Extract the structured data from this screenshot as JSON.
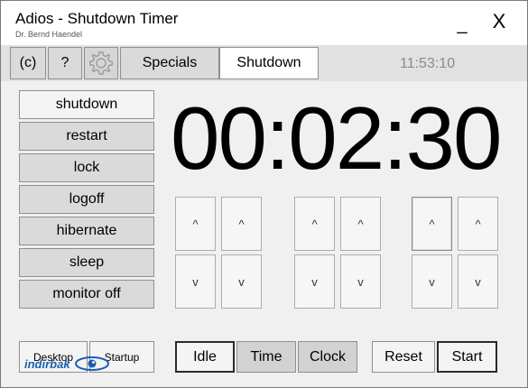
{
  "window": {
    "title": "Adios - Shutdown Timer",
    "subtitle": "Dr. Bernd Haendel",
    "minimize_label": "_",
    "close_label": "X"
  },
  "toolbar": {
    "copyright_label": "(c)",
    "help_label": "?",
    "specials_label": "Specials",
    "shutdown_label": "Shutdown",
    "current_time": "11:53:10"
  },
  "actions": [
    {
      "label": "shutdown",
      "selected": true
    },
    {
      "label": "restart",
      "selected": false
    },
    {
      "label": "lock",
      "selected": false
    },
    {
      "label": "logoff",
      "selected": false
    },
    {
      "label": "hibernate",
      "selected": false
    },
    {
      "label": "sleep",
      "selected": false
    },
    {
      "label": "monitor off",
      "selected": false
    }
  ],
  "timer": {
    "display": "00:02:30"
  },
  "spinners": {
    "up_glyph": "^",
    "down_glyph": "v"
  },
  "bottom": {
    "desktop_label": "Desktop",
    "startup_label": "Startup",
    "idle_label": "Idle",
    "time_label": "Time",
    "clock_label": "Clock",
    "reset_label": "Reset",
    "start_label": "Start"
  },
  "watermark": {
    "text": "indirbak"
  },
  "colors": {
    "window_bg": "#f0f0f0",
    "toolbar_bg": "#e1e1e1",
    "button_bg": "#dadada",
    "selected_bg": "#f4f4f4",
    "clock_text": "#8a8a8a",
    "watermark_blue": "#1b5fb0"
  },
  "icons": {
    "settings": "gear-icon",
    "watermark_logo": "eye-logo-icon"
  }
}
